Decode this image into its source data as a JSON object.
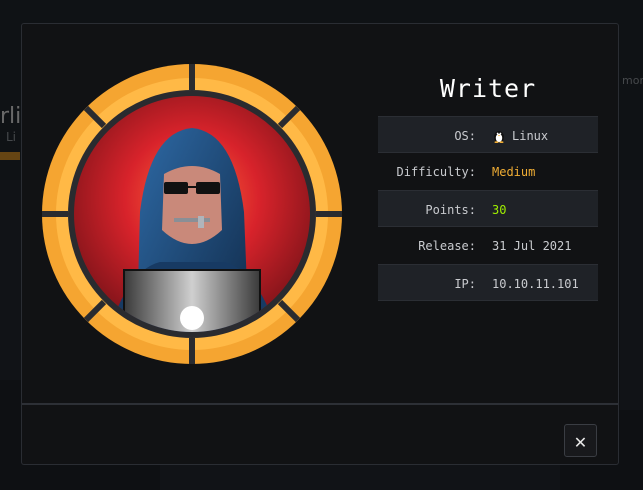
{
  "background": {
    "title_fragment": "rli",
    "subtitle_fragment": "Li",
    "right_fragment": "mont"
  },
  "modal": {
    "title": "Writer",
    "rows": [
      {
        "label": "OS:",
        "value": "Linux",
        "icon": "tux-icon"
      },
      {
        "label": "Difficulty:",
        "value": "Medium"
      },
      {
        "label": "Points:",
        "value": "30"
      },
      {
        "label": "Release:",
        "value": "31 Jul 2021"
      },
      {
        "label": "IP:",
        "value": "10.10.11.101"
      }
    ],
    "close_label": "✕"
  },
  "colors": {
    "ring": "#f5a531",
    "difficulty_medium": "#f0ad34",
    "points": "#9fef00",
    "modal_bg": "#111214"
  }
}
